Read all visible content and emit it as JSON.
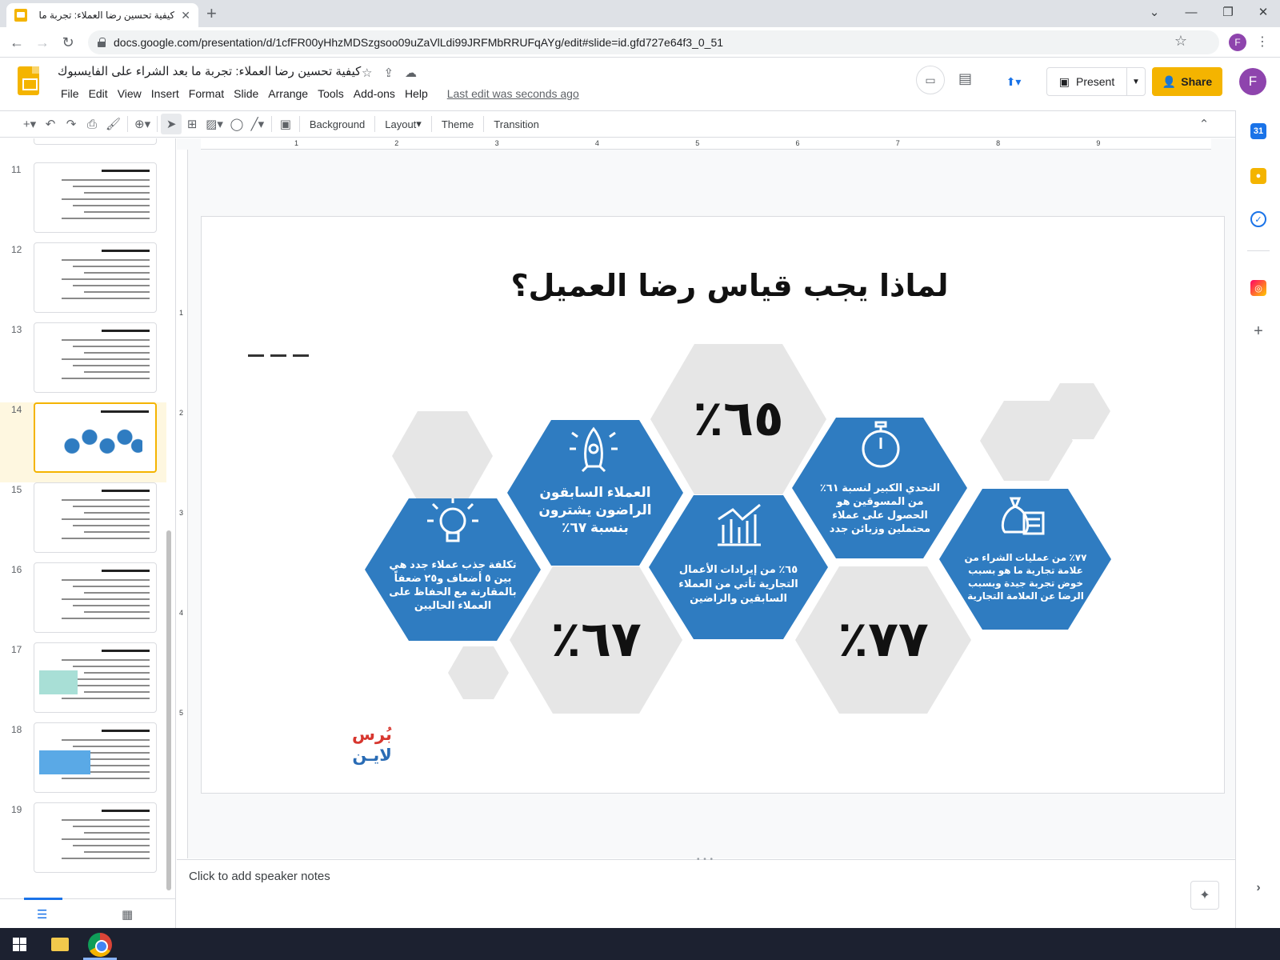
{
  "browser": {
    "tab_title": "كيفية تحسين رضا العملاء: تجربة ما",
    "url": "docs.google.com/presentation/d/1cfFR00yHhzMDSzgsoo09uZaVlLdi99JRFMbRRUFqAYg/edit#slide=id.gfd727e64f3_0_51"
  },
  "app": {
    "doc_title": "كيفية تحسين رضا العملاء: تجربة ما بعد الشراء على الفايسبوك",
    "menus": [
      "File",
      "Edit",
      "View",
      "Insert",
      "Format",
      "Slide",
      "Arrange",
      "Tools",
      "Add-ons",
      "Help"
    ],
    "last_edit": "Last edit was seconds ago",
    "present_label": "Present",
    "share_label": "Share",
    "avatar_letter": "F"
  },
  "toolbar": {
    "background": "Background",
    "layout": "Layout",
    "theme": "Theme",
    "transition": "Transition"
  },
  "filmstrip": {
    "slides": [
      {
        "num": "11",
        "active": false
      },
      {
        "num": "12",
        "active": false
      },
      {
        "num": "13",
        "active": false
      },
      {
        "num": "14",
        "active": true
      },
      {
        "num": "15",
        "active": false
      },
      {
        "num": "16",
        "active": false
      },
      {
        "num": "17",
        "active": false
      },
      {
        "num": "18",
        "active": false
      },
      {
        "num": "19",
        "active": false
      }
    ]
  },
  "ruler": {
    "top_ticks": [
      "1",
      "2",
      "3",
      "4",
      "5",
      "6",
      "7",
      "8",
      "9"
    ],
    "left_ticks": [
      "1",
      "2",
      "3",
      "4",
      "5"
    ]
  },
  "slide": {
    "title": "لماذا يجب قياس رضا العميل؟",
    "stat_65": "٦٥٪",
    "stat_67": "٦٧٪",
    "stat_77": "٧٧٪",
    "hex_attraction": "تكلفة جذب عملاء جدد هي بين ٥ أضعاف و٢٥ ضعفاً بالمقارنة مع الحفاظ على العملاء الحاليين",
    "hex_previous": "العملاء السابقون الراضون يشترون بنسبة ٦٧٪",
    "hex_revenue": "٦٥٪ من إيرادات الأعمال التجارية تأتي من العملاء السابقين والراضين",
    "hex_challenge": "التحدي الكبير لنسبة ٦١٪ من المسوقين هو الحصول على عملاء محتملين وزبائن جدد",
    "hex_purchases": "٧٧٪ من عمليات الشراء من علامة تجارية ما هو بسبب خوض تجربة جيدة وبسبب الرضا عن العلامة التجارية",
    "brand_line1": "بُرس",
    "brand_line2": "لايـن",
    "colors": {
      "blue": "#2f7cc1",
      "gray": "#e6e6e6",
      "brand_red": "#d7372f",
      "brand_blue": "#2a6cb5"
    }
  },
  "notes": {
    "placeholder": "Click to add speaker notes"
  }
}
